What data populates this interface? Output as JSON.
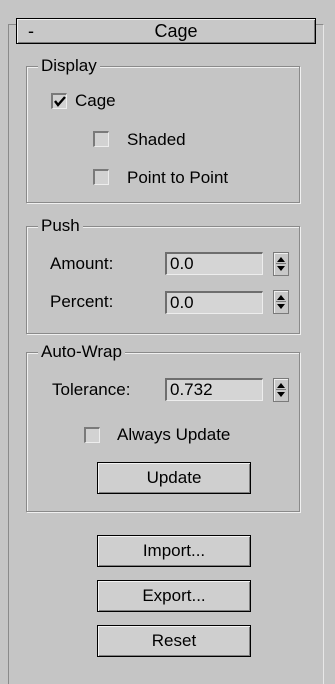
{
  "rollout": {
    "toggle": "-",
    "title": "Cage"
  },
  "display": {
    "group_label": "Display",
    "cage": {
      "label": "Cage",
      "checked": true
    },
    "shaded": {
      "label": "Shaded",
      "checked": false
    },
    "point_to_point": {
      "label": "Point to Point",
      "checked": false
    }
  },
  "push": {
    "group_label": "Push",
    "amount": {
      "label": "Amount:",
      "value": "0.0"
    },
    "percent": {
      "label": "Percent:",
      "value": "0.0"
    }
  },
  "auto_wrap": {
    "group_label": "Auto-Wrap",
    "tolerance": {
      "label": "Tolerance:",
      "value": "0.732"
    },
    "always_update": {
      "label": "Always Update",
      "checked": false
    },
    "update_button": "Update"
  },
  "actions": {
    "import": "Import...",
    "export": "Export...",
    "reset": "Reset"
  }
}
